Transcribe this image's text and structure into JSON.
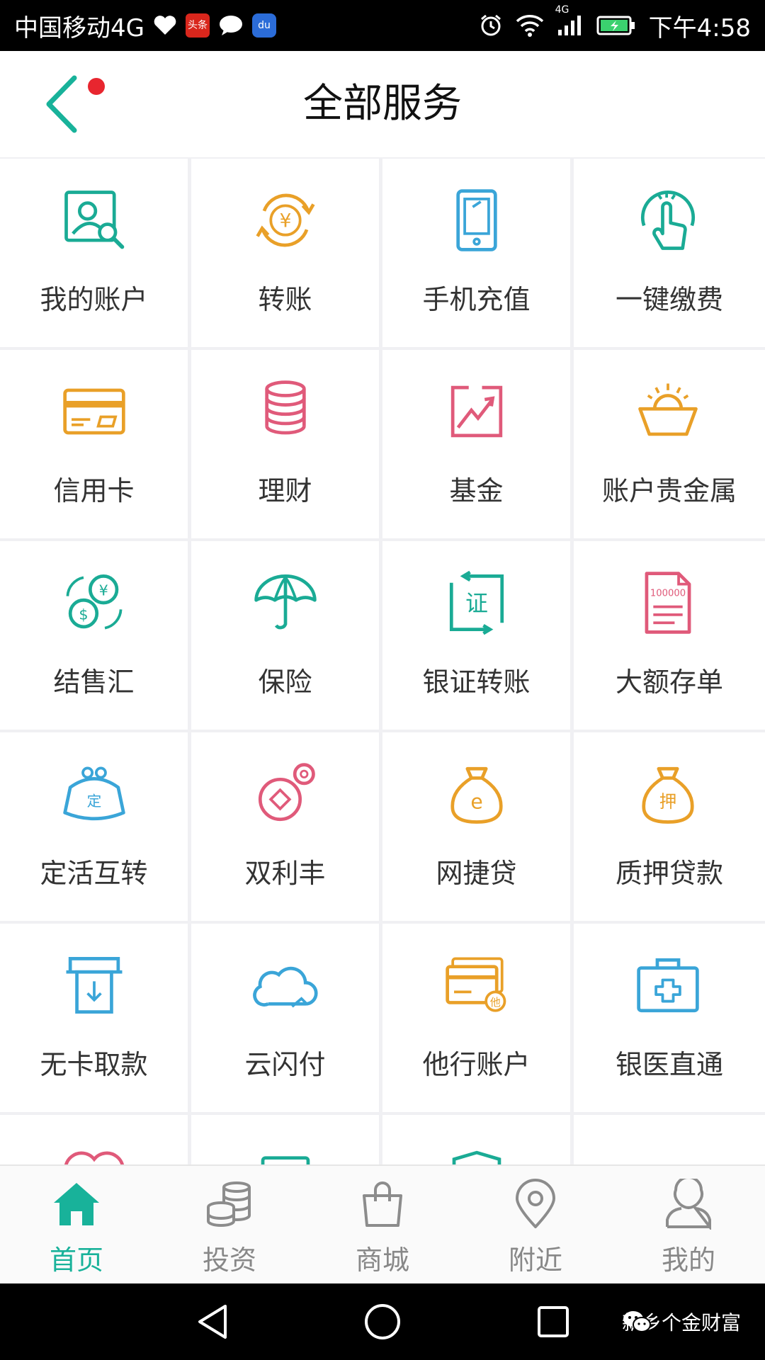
{
  "status_bar": {
    "carrier": "中国移动4G",
    "time": "下午4:58",
    "network": "4G",
    "notif_news": "头条",
    "notif_baidu": "du"
  },
  "header": {
    "title": "全部服务"
  },
  "services": [
    {
      "label": "我的账户",
      "icon": "account-search-icon",
      "color": "#1aab95"
    },
    {
      "label": "转账",
      "icon": "transfer-icon",
      "color": "#e9a028"
    },
    {
      "label": "手机充值",
      "icon": "phone-icon",
      "color": "#3aa5d8"
    },
    {
      "label": "一键缴费",
      "icon": "tap-icon",
      "color": "#1aab95"
    },
    {
      "label": "信用卡",
      "icon": "credit-card-icon",
      "color": "#e9a028"
    },
    {
      "label": "理财",
      "icon": "coin-stack-icon",
      "color": "#e05a7a"
    },
    {
      "label": "基金",
      "icon": "chart-icon",
      "color": "#e05a7a"
    },
    {
      "label": "账户贵金属",
      "icon": "gold-ingot-icon",
      "color": "#e9a028"
    },
    {
      "label": "结售汇",
      "icon": "exchange-icon",
      "color": "#1aab95"
    },
    {
      "label": "保险",
      "icon": "umbrella-icon",
      "color": "#1aab95"
    },
    {
      "label": "银证转账",
      "icon": "securities-icon",
      "color": "#1aab95"
    },
    {
      "label": "大额存单",
      "icon": "document-icon",
      "color": "#e05a7a"
    },
    {
      "label": "定活互转",
      "icon": "purse-icon",
      "color": "#3aa5d8"
    },
    {
      "label": "双利丰",
      "icon": "coins-icon",
      "color": "#e05a7a"
    },
    {
      "label": "网捷贷",
      "icon": "money-bag-e-icon",
      "color": "#e9a028"
    },
    {
      "label": "质押贷款",
      "icon": "money-bag-pledge-icon",
      "color": "#e9a028"
    },
    {
      "label": "无卡取款",
      "icon": "atm-icon",
      "color": "#3aa5d8"
    },
    {
      "label": "云闪付",
      "icon": "cloud-icon",
      "color": "#3aa5d8"
    },
    {
      "label": "他行账户",
      "icon": "cards-icon",
      "color": "#e9a028"
    },
    {
      "label": "银医直通",
      "icon": "medical-kit-icon",
      "color": "#3aa5d8"
    }
  ],
  "service_glyphs": {
    "transfer": "¥",
    "securities": "证",
    "document": "100000",
    "purse": "定",
    "money_bag_e": "e",
    "money_bag_pledge": "押",
    "cards": "他"
  },
  "bottom_nav": [
    {
      "label": "首页",
      "icon": "home-icon",
      "active": true
    },
    {
      "label": "投资",
      "icon": "coins-stack-icon",
      "active": false
    },
    {
      "label": "商城",
      "icon": "shopping-bag-icon",
      "active": false
    },
    {
      "label": "附近",
      "icon": "location-pin-icon",
      "active": false
    },
    {
      "label": "我的",
      "icon": "user-icon",
      "active": false
    }
  ],
  "watermark": "新乡个金财富",
  "colors": {
    "accent": "#18b29a",
    "teal": "#1aab95",
    "orange": "#e9a028",
    "blue": "#3aa5d8",
    "pink": "#e05a7a"
  }
}
